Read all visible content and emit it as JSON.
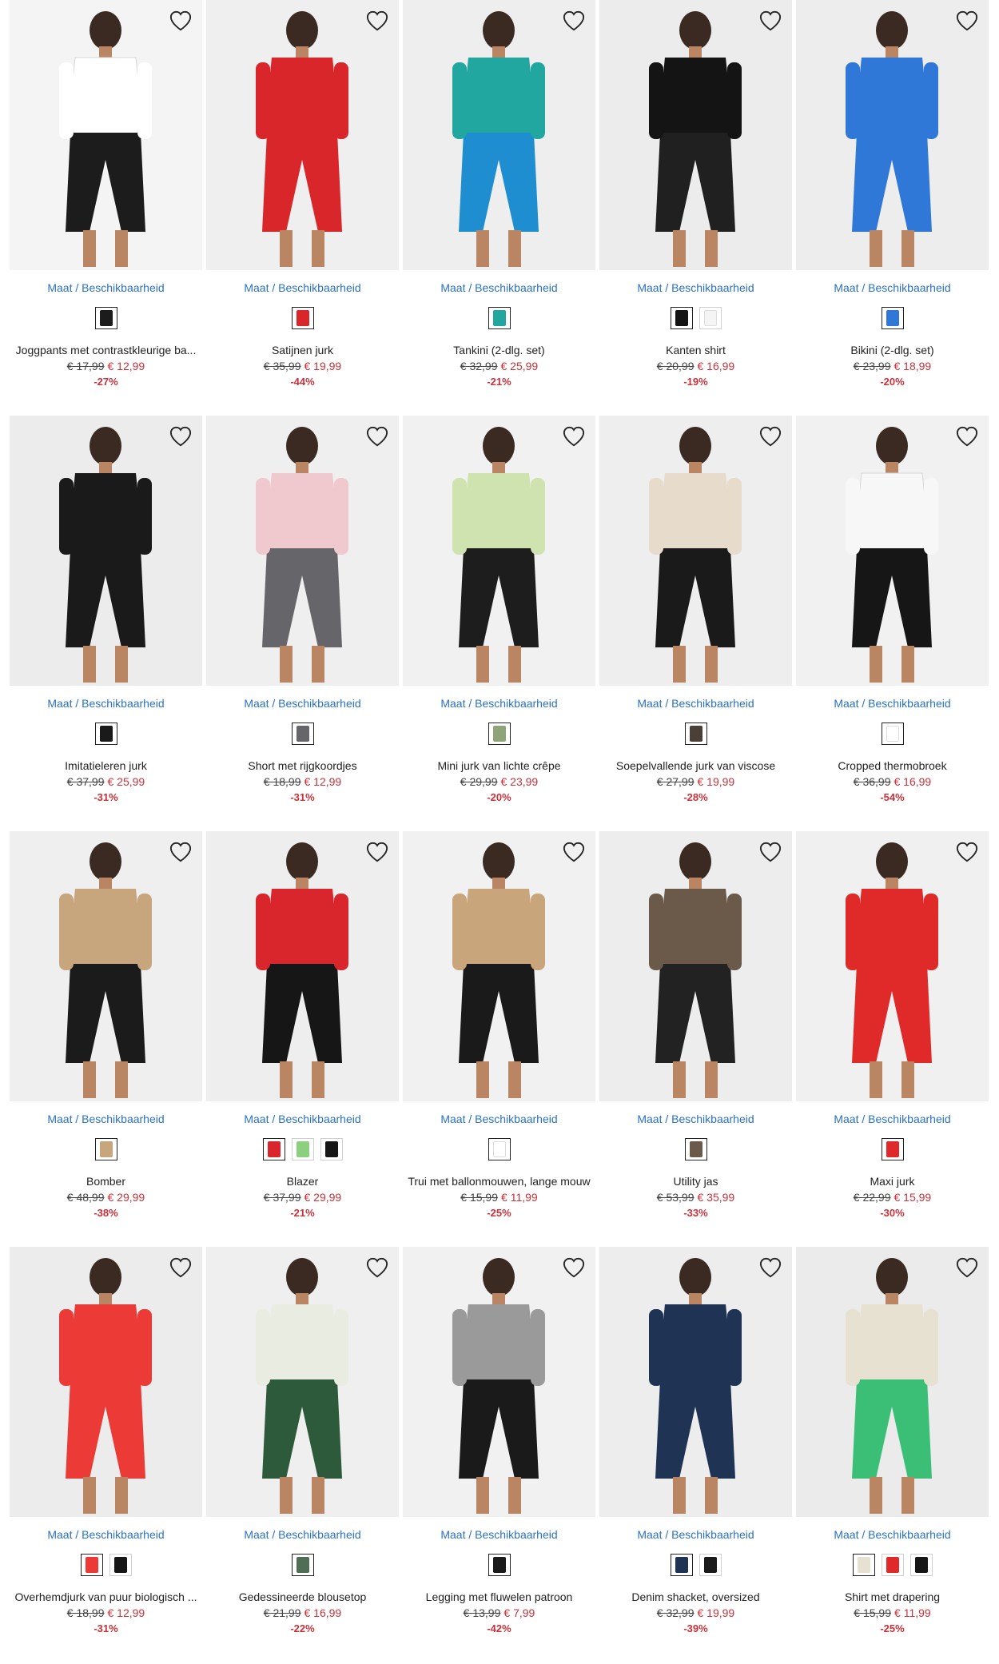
{
  "maat_label": "Maat / Beschikbaarheid",
  "products": [
    {
      "name": "Joggpants met contrastkleurige ba...",
      "old": "€ 17,99",
      "new": "€ 12,99",
      "disc": "-27%",
      "bg": "#f4f4f4",
      "top": "#ffffff",
      "bottom": "#1c1c1c",
      "swatches": [
        "#1c1c1c"
      ]
    },
    {
      "name": "Satijnen jurk",
      "old": "€ 35,99",
      "new": "€ 19,99",
      "disc": "-44%",
      "bg": "#efefef",
      "top": "#d8262a",
      "bottom": "#d8262a",
      "swatches": [
        "#d8262a"
      ]
    },
    {
      "name": "Tankini (2-dlg. set)",
      "old": "€ 32,99",
      "new": "€ 25,99",
      "disc": "-21%",
      "bg": "#eeeeee",
      "top": "#21a6a0",
      "bottom": "#1e8ed0",
      "swatches": [
        "#21a6a0"
      ]
    },
    {
      "name": "Kanten shirt",
      "old": "€ 20,99",
      "new": "€ 16,99",
      "disc": "-19%",
      "bg": "#ececec",
      "top": "#141414",
      "bottom": "#202020",
      "swatches": [
        "#141414",
        "#f4f4f4"
      ]
    },
    {
      "name": "Bikini (2-dlg. set)",
      "old": "€ 23,99",
      "new": "€ 18,99",
      "disc": "-20%",
      "bg": "#ededed",
      "top": "#2f78d8",
      "bottom": "#2f78d8",
      "swatches": [
        "#2f78d8"
      ]
    },
    {
      "name": "Imitatieleren jurk",
      "old": "€ 37,99",
      "new": "€ 25,99",
      "disc": "-31%",
      "bg": "#ececec",
      "top": "#1a1a1a",
      "bottom": "#1a1a1a",
      "swatches": [
        "#1a1a1a"
      ]
    },
    {
      "name": "Short met rijgkoordjes",
      "old": "€ 18,99",
      "new": "€ 12,99",
      "disc": "-31%",
      "bg": "#efefef",
      "top": "#f0c9cf",
      "bottom": "#66666a",
      "swatches": [
        "#66666a"
      ]
    },
    {
      "name": "Mini jurk van lichte crêpe",
      "old": "€ 29,99",
      "new": "€ 23,99",
      "disc": "-20%",
      "bg": "#f1f1f1",
      "top": "#cfe3b0",
      "bottom": "#1d1d1d",
      "swatches": [
        "#8fa579"
      ]
    },
    {
      "name": "Soepelvallende jurk van viscose",
      "old": "€ 27,99",
      "new": "€ 19,99",
      "disc": "-28%",
      "bg": "#eeeeee",
      "top": "#e7dccb",
      "bottom": "#1a1a1a",
      "swatches": [
        "#4a4038"
      ]
    },
    {
      "name": "Cropped thermobroek",
      "old": "€ 36,99",
      "new": "€ 16,99",
      "disc": "-54%",
      "bg": "#f1f1f1",
      "top": "#f7f7f7",
      "bottom": "#161616",
      "swatches": [
        "#ffffff"
      ]
    },
    {
      "name": "Bomber",
      "old": "€ 48,99",
      "new": "€ 29,99",
      "disc": "-38%",
      "bg": "#efefef",
      "top": "#c7a57d",
      "bottom": "#1b1b1b",
      "swatches": [
        "#c7a57d"
      ]
    },
    {
      "name": "Blazer",
      "old": "€ 37,99",
      "new": "€ 29,99",
      "disc": "-21%",
      "bg": "#eeeeee",
      "top": "#d9262d",
      "bottom": "#161616",
      "swatches": [
        "#d9262d",
        "#8ccf7e",
        "#161616"
      ]
    },
    {
      "name": "Trui met ballonmouwen, lange mouw",
      "old": "€ 15,99",
      "new": "€ 11,99",
      "disc": "-25%",
      "bg": "#f1f1f1",
      "top": "#c8a57a",
      "bottom": "#1a1a1a",
      "swatches": [
        "#ffffff"
      ]
    },
    {
      "name": "Utility jas",
      "old": "€ 53,99",
      "new": "€ 35,99",
      "disc": "-33%",
      "bg": "#ededed",
      "top": "#6b5a4a",
      "bottom": "#222222",
      "swatches": [
        "#6b5a4a"
      ]
    },
    {
      "name": "Maxi jurk",
      "old": "€ 22,99",
      "new": "€ 15,99",
      "disc": "-30%",
      "bg": "#f0f0f0",
      "top": "#e02a2a",
      "bottom": "#e02a2a",
      "swatches": [
        "#e02a2a"
      ]
    },
    {
      "name": "Overhemdjurk van puur biologisch ...",
      "old": "€ 18,99",
      "new": "€ 12,99",
      "disc": "-31%",
      "bg": "#ececec",
      "top": "#ec3a36",
      "bottom": "#ec3a36",
      "swatches": [
        "#ec3a36",
        "#161616"
      ]
    },
    {
      "name": "Gedessineerde blousetop",
      "old": "€ 21,99",
      "new": "€ 16,99",
      "disc": "-22%",
      "bg": "#efefef",
      "top": "#e9ece0",
      "bottom": "#2c5a3a",
      "swatches": [
        "#4f6e54"
      ]
    },
    {
      "name": "Legging met fluwelen patroon",
      "old": "€ 13,99",
      "new": "€ 7,99",
      "disc": "-42%",
      "bg": "#f1f1f1",
      "top": "#9a9a9a",
      "bottom": "#1a1a1a",
      "swatches": [
        "#1a1a1a"
      ]
    },
    {
      "name": "Denim shacket, oversized",
      "old": "€ 32,99",
      "new": "€ 19,99",
      "disc": "-39%",
      "bg": "#ededed",
      "top": "#1f3354",
      "bottom": "#1f3354",
      "swatches": [
        "#1f3354",
        "#1a1a1a"
      ]
    },
    {
      "name": "Shirt met drapering",
      "old": "€ 15,99",
      "new": "€ 11,99",
      "disc": "-25%",
      "bg": "#ebebeb",
      "top": "#e7e1d2",
      "bottom": "#3bbf77",
      "swatches": [
        "#e7e1d2",
        "#e02a2a",
        "#161616"
      ]
    }
  ]
}
